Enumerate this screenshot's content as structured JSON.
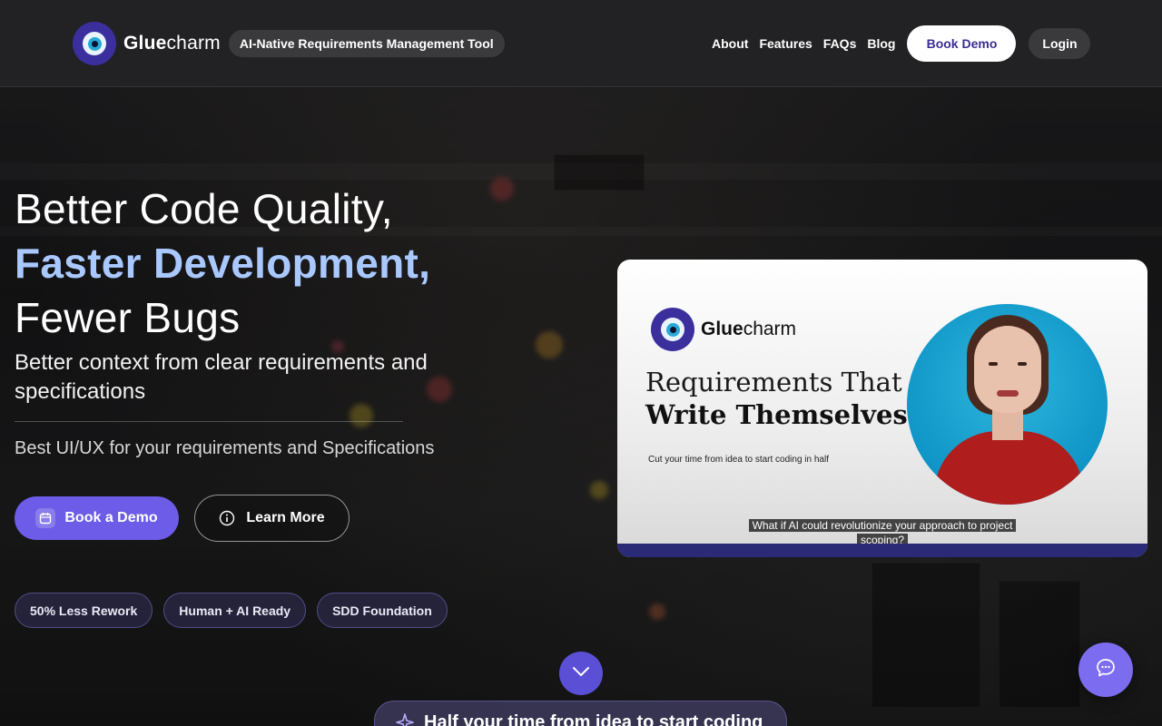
{
  "header": {
    "brand_prefix": "Glue",
    "brand_suffix": "charm",
    "tagline": "AI-Native Requirements Management Tool",
    "nav": [
      {
        "label": "About"
      },
      {
        "label": "Features"
      },
      {
        "label": "FAQs"
      },
      {
        "label": "Blog"
      }
    ],
    "book_demo_label": "Book Demo",
    "login_label": "Login"
  },
  "hero": {
    "line1": "Better Code Quality,",
    "line2": "Faster Development,",
    "line3": "Fewer Bugs",
    "subtitle": "Better context from clear requirements and specifications",
    "subtitle2": "Best UI/UX for your requirements and Specifications",
    "primary_cta": "Book a Demo",
    "secondary_cta": "Learn More",
    "badges": [
      {
        "label": "50% Less Rework"
      },
      {
        "label": "Human + AI Ready"
      },
      {
        "label": "SDD Foundation"
      }
    ],
    "accent_color": "#a9c8ff"
  },
  "video": {
    "brand_prefix": "Glue",
    "brand_suffix": "charm",
    "title_line1": "Requirements That",
    "title_line2": "Write Themselves",
    "small_text": "Cut your time from idea to start coding in half",
    "caption_line1": "What if AI could revolutionize your approach to project",
    "caption_line2": "scoping?"
  },
  "bottom_banner": {
    "text": "Half your time from idea to start coding"
  },
  "icons": {
    "logo": "eye-logo-icon",
    "calendar": "calendar-icon",
    "info": "info-icon",
    "chevron": "chevron-down-icon",
    "chat": "chat-bubble-icon",
    "sparkle": "sparkle-icon"
  },
  "colors": {
    "primary": "#6c5ce7",
    "brand_dark": "#3b2f9e",
    "video_bar": "#2b2a76"
  }
}
